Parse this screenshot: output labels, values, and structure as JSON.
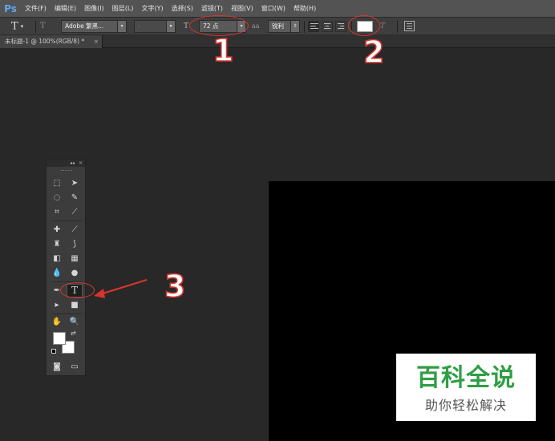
{
  "menubar": {
    "logo": "Ps",
    "items": [
      "文件(F)",
      "编辑(E)",
      "图像(I)",
      "图层(L)",
      "文字(Y)",
      "选择(S)",
      "滤镜(T)",
      "视图(V)",
      "窗口(W)",
      "帮助(H)"
    ]
  },
  "options_bar": {
    "tool_preset_icon": "T",
    "orientation_icon": "T",
    "font_family": "Adobe 繁黑...",
    "font_style": "-",
    "size_icon": "T",
    "font_size": "72 点",
    "aa_icon": "aa",
    "anti_alias": "锐利",
    "text_color": "#ffffff",
    "warp_icon": "T",
    "icons": [
      "text-tool-preset-icon",
      "text-orientation-icon",
      "font-size-icon",
      "anti-alias-icon",
      "align-left-icon",
      "align-center-icon",
      "align-right-icon",
      "warp-text-icon",
      "character-panel-icon"
    ]
  },
  "document": {
    "tab_title": "未标题-1 @ 100%(RGB/8) *",
    "close": "×",
    "canvas_color": "#000000"
  },
  "toolbox": {
    "collapse": "◂◂",
    "close": "×",
    "type_tool_glyph": "T",
    "foreground_color": "#ffffff",
    "background_color": "#ffffff",
    "swap": "⇄",
    "selected_tool": "type-tool"
  },
  "annotations": {
    "labels": [
      "1",
      "2",
      "3"
    ],
    "color": "#d9352e"
  },
  "watermark": {
    "title": "百科全说",
    "subtitle": "助你轻松解决"
  }
}
